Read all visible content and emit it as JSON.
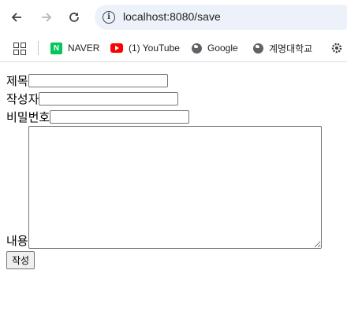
{
  "browser": {
    "url": "localhost:8080/save",
    "back_icon": "arrow-left-icon",
    "forward_icon": "arrow-right-icon",
    "reload_icon": "reload-icon"
  },
  "bookmarks": [
    {
      "label": "NAVER",
      "icon": "naver-icon"
    },
    {
      "label": "(1) YouTube",
      "icon": "youtube-icon"
    },
    {
      "label": "Google",
      "icon": "globe-icon"
    },
    {
      "label": "계명대학교",
      "icon": "globe-icon"
    }
  ],
  "form": {
    "title_label": "제목",
    "title_value": "",
    "author_label": "작성자",
    "author_value": "",
    "password_label": "비밀번호",
    "password_value": "",
    "content_label": "내용",
    "content_value": "",
    "submit_label": "작성"
  }
}
